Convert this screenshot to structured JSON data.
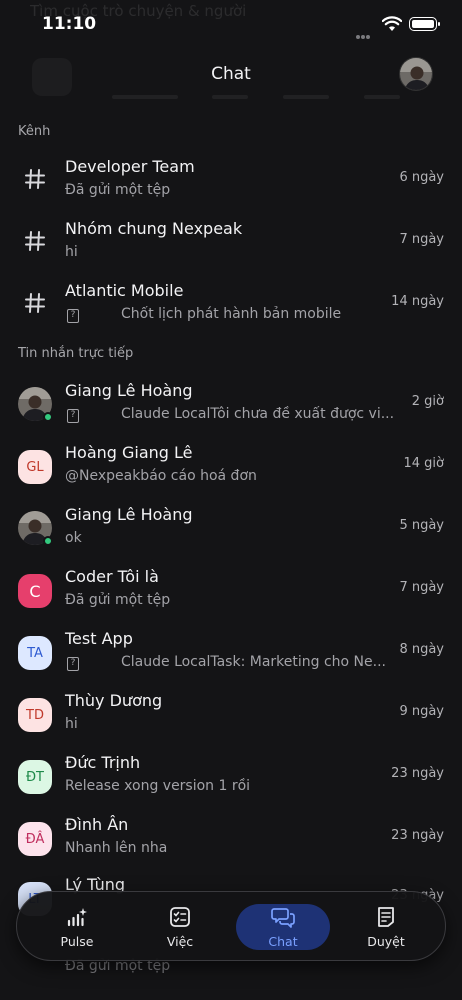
{
  "status": {
    "time": "11:10"
  },
  "search": {
    "placeholder": "Tìm cuộc trò chuyện & người"
  },
  "header": {
    "title": "Chat"
  },
  "sections": {
    "channels": "Kênh",
    "direct": "Tin nhắn trực tiếp"
  },
  "channels": [
    {
      "name": "Developer Team",
      "preview": "Đã gửi một tệp",
      "time": "6 ngày"
    },
    {
      "name": "Nhóm chung Nexpeak",
      "preview": "hi",
      "time": "7 ngày"
    },
    {
      "name": "Atlantic Mobile",
      "preview": "Chốt lịch phát hành bản mobile",
      "time": "14 ngày"
    }
  ],
  "direct": [
    {
      "name": "Giang Lê Hoàng",
      "preview": "Claude LocalTôi chưa đề xuất được vi...",
      "time": "2 giờ",
      "initials": "",
      "avatar_bg": "",
      "avatar_fg": ""
    },
    {
      "name": "Hoàng Giang Lê",
      "preview": "@Nexpeakbáo cáo hoá đơn",
      "time": "14 giờ",
      "initials": "GL",
      "avatar_bg": "#fde3e3",
      "avatar_fg": "#c0392b"
    },
    {
      "name": "Giang Lê Hoàng",
      "preview": "ok",
      "time": "5 ngày",
      "initials": "",
      "avatar_bg": "",
      "avatar_fg": ""
    },
    {
      "name": "Coder Tôi là",
      "preview": "Đã gửi một tệp",
      "time": "7 ngày",
      "initials": "C",
      "avatar_bg": "#e63f6c",
      "avatar_fg": "#ffffff"
    },
    {
      "name": "Test App",
      "preview": "Claude LocalTask: Marketing cho Ne...",
      "time": "8 ngày",
      "initials": "TA",
      "avatar_bg": "#dde8ff",
      "avatar_fg": "#2f5bd1"
    },
    {
      "name": "Thùy Dương",
      "preview": "hi",
      "time": "9 ngày",
      "initials": "TD",
      "avatar_bg": "#fde3e3",
      "avatar_fg": "#c0392b"
    },
    {
      "name": "Đức Trịnh",
      "preview": "Release xong version 1 rồi",
      "time": "23 ngày",
      "initials": "ĐT",
      "avatar_bg": "#dcf7e4",
      "avatar_fg": "#1e8a4a"
    },
    {
      "name": "Đình Ân",
      "preview": "Nhanh lên nha",
      "time": "23 ngày",
      "initials": "ĐÂ",
      "avatar_bg": "#fde3ec",
      "avatar_fg": "#c02e5e"
    },
    {
      "name": "Lý Tùng",
      "preview": "Đã gửi một tệp",
      "time": "23 ngày",
      "initials": "LT",
      "avatar_bg": "#dde8ff",
      "avatar_fg": "#2f5bd1"
    }
  ],
  "tabs": [
    {
      "label": "Pulse",
      "icon": "pulse-chart-icon"
    },
    {
      "label": "Việc",
      "icon": "checklist-icon"
    },
    {
      "label": "Chat",
      "icon": "chat-bubbles-icon"
    },
    {
      "label": "Duyệt",
      "icon": "approval-doc-icon"
    }
  ],
  "colors": {
    "background": "#141416",
    "accent": "#7aa0ff",
    "active_pill": "#1e3275",
    "online": "#33c97e"
  }
}
